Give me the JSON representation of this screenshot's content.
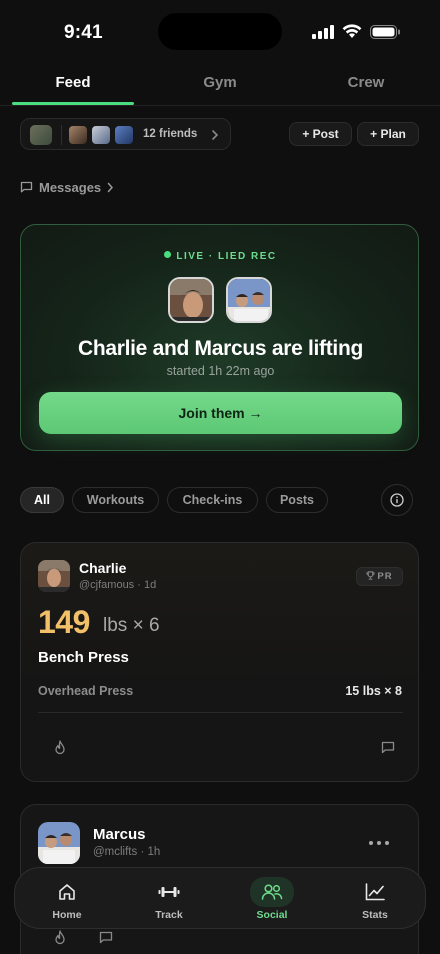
{
  "status_bar": {
    "time": "9:41"
  },
  "tabs": [
    {
      "label": "Feed",
      "active": true
    },
    {
      "label": "Gym",
      "active": false
    },
    {
      "label": "Crew",
      "active": false
    }
  ],
  "friends": {
    "count_label": "12 friends"
  },
  "actions": {
    "post_label": "+ Post",
    "plan_label": "+ Plan"
  },
  "messages": {
    "label": "Messages"
  },
  "live": {
    "tag": "LIVE · LIED REC",
    "title": "Charlie and Marcus are lifting",
    "subtitle": "started 1h 22m ago",
    "join_label": "Join them →"
  },
  "filters": [
    {
      "label": "All",
      "active": true
    },
    {
      "label": "Workouts",
      "active": false
    },
    {
      "label": "Check-ins",
      "active": false
    },
    {
      "label": "Posts",
      "active": false
    }
  ],
  "posts": [
    {
      "name": "Charlie",
      "handle": "@cjfamous · 1d",
      "badge": "PR",
      "weight": "149",
      "unit": "lbs × 6",
      "exercise": "Bench Press",
      "extra_label": "Overhead Press",
      "extra_value": "15 lbs × 8"
    },
    {
      "name": "Marcus",
      "handle": "@mclifts · 1h"
    }
  ],
  "nav": [
    {
      "label": "Home",
      "icon": "home-icon"
    },
    {
      "label": "Track",
      "icon": "dumbbell-icon"
    },
    {
      "label": "Social",
      "icon": "people-icon",
      "active": true
    },
    {
      "label": "Stats",
      "icon": "chart-icon"
    }
  ],
  "colors": {
    "accent": "#4ade80",
    "pr_gold": "#f2c068",
    "background": "#0f0f0f"
  }
}
